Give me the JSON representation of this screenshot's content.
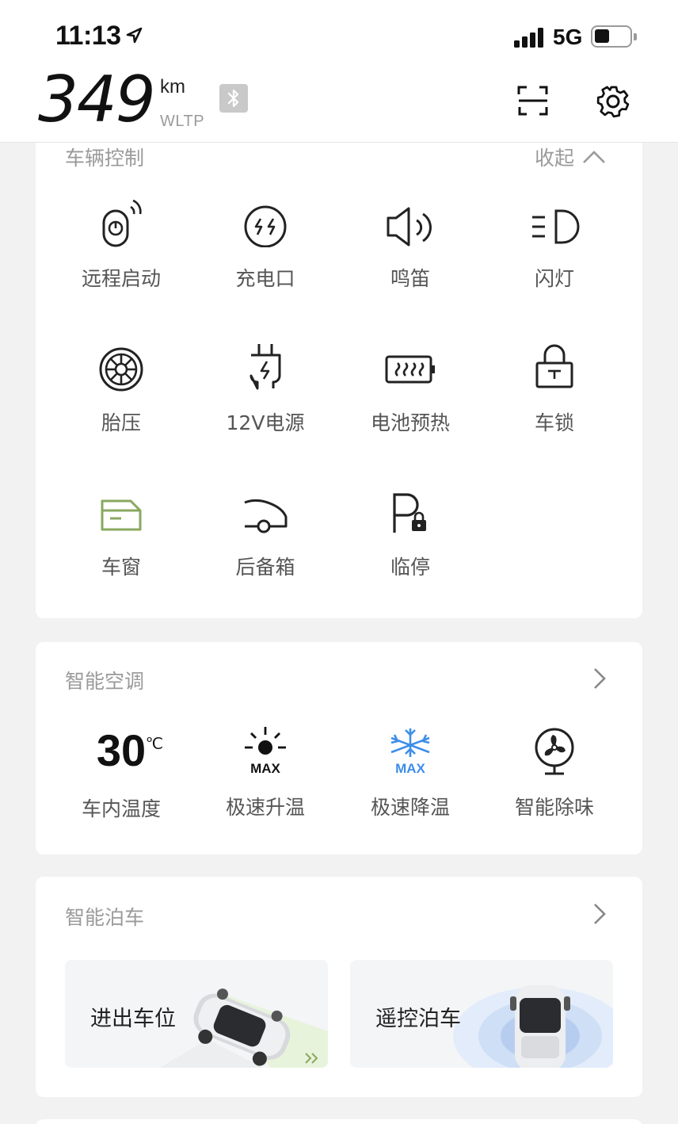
{
  "status_bar": {
    "time": "11:13",
    "network": "5G",
    "battery_level": 0.45
  },
  "header": {
    "range_value": "349",
    "range_unit": "km",
    "range_standard": "WLTP"
  },
  "vehicle_control": {
    "title": "车辆控制",
    "collapse_label": "收起",
    "items": [
      {
        "label": "远程启动",
        "icon": "remote-start-icon"
      },
      {
        "label": "充电口",
        "icon": "charge-port-icon"
      },
      {
        "label": "鸣笛",
        "icon": "horn-icon"
      },
      {
        "label": "闪灯",
        "icon": "headlight-icon"
      },
      {
        "label": "胎压",
        "icon": "tire-pressure-icon"
      },
      {
        "label": "12V电源",
        "icon": "12v-power-icon"
      },
      {
        "label": "电池预热",
        "icon": "battery-preheat-icon"
      },
      {
        "label": "车锁",
        "icon": "car-lock-icon"
      },
      {
        "label": "车窗",
        "icon": "window-icon",
        "color": "#8aa860"
      },
      {
        "label": "后备箱",
        "icon": "trunk-icon"
      },
      {
        "label": "临停",
        "icon": "temporary-parking-icon"
      }
    ]
  },
  "climate": {
    "title": "智能空调",
    "cabin_temp": "30",
    "temp_unit": "℃",
    "items": [
      {
        "label": "车内温度"
      },
      {
        "label": "极速升温",
        "icon": "sun-max-icon",
        "badge": "MAX"
      },
      {
        "label": "极速降温",
        "icon": "snowflake-max-icon",
        "badge": "MAX",
        "color": "#3d8ee8"
      },
      {
        "label": "智能除味",
        "icon": "fan-icon"
      }
    ]
  },
  "parking": {
    "title": "智能泊车",
    "tiles": [
      {
        "label": "进出车位"
      },
      {
        "label": "遥控泊车"
      }
    ]
  }
}
